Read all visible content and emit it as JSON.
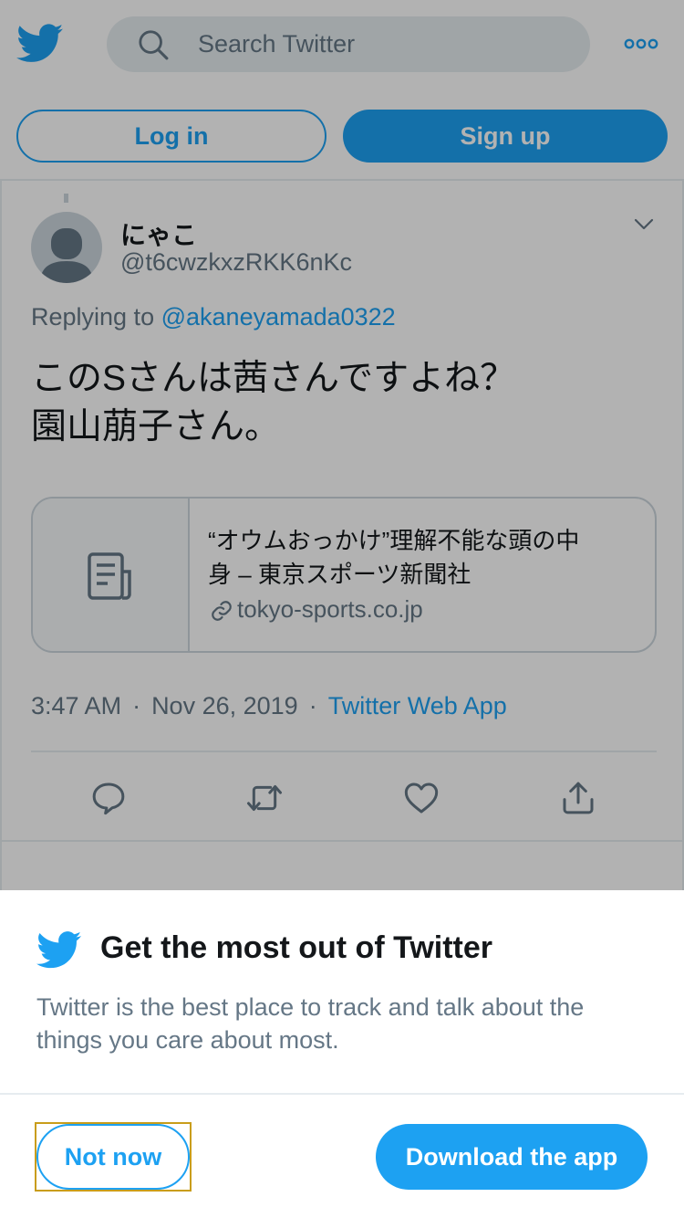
{
  "header": {
    "logo_icon": "twitter-bird-icon",
    "search": {
      "placeholder": "Search Twitter",
      "icon": "search-icon"
    },
    "more_icon": "more-dots-icon",
    "login_label": "Log in",
    "signup_label": "Sign up"
  },
  "tweet": {
    "display_name": "にゃこ",
    "username": "@t6cwzkxzRKK6nKc",
    "reply_prefix": "Replying to",
    "reply_to": "@akaneyamada0322",
    "text": "このSさんは茜さんですよね？\n園山萠子さん。",
    "card": {
      "title": "“オウムおっかけ”理解不能な頭の中\n身 – 東京スポーツ新聞社",
      "domain": "tokyo-sports.co.jp",
      "thumb_icon": "document-icon",
      "link_icon": "link-icon"
    },
    "time": "3:47 AM",
    "date": "Nov 26, 2019",
    "separator": "·",
    "source": "Twitter Web App",
    "actions": [
      "reply-icon",
      "retweet-icon",
      "like-icon",
      "share-icon"
    ]
  },
  "sheet": {
    "title": "Get the most out of Twitter",
    "body": "Twitter is the best place to track and talk about the things you care about most.",
    "not_now_label": "Not now",
    "download_label": "Download the app"
  },
  "colors": {
    "accent": "#1da1f2",
    "text_primary": "#14171a",
    "text_secondary": "#657786",
    "border": "#e6ecf0"
  }
}
